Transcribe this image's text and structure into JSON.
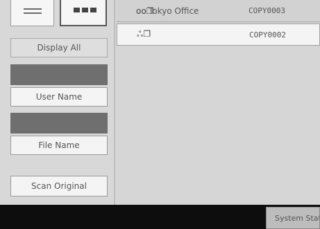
{
  "sidebar": {
    "display_all": "Display All",
    "user_name": "User Name",
    "file_name": "File Name",
    "scan_original": "Scan Original"
  },
  "list": {
    "rows": [
      {
        "icon": "oo❐",
        "name": "Tokyo Office",
        "code": "COPY0003"
      },
      {
        "icon": "ஃ❐",
        "name": "",
        "code": "COPY0002"
      }
    ]
  },
  "footer": {
    "system_status": "System Status"
  }
}
